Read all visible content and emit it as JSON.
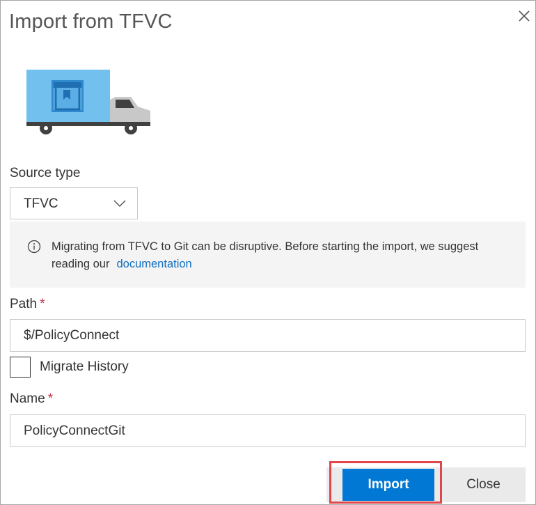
{
  "dialog": {
    "title": "Import from TFVC",
    "close_icon": "close-icon",
    "illustration": "truck-illustration"
  },
  "source_type": {
    "label": "Source type",
    "value": "TFVC",
    "icon": "chevron-down-icon"
  },
  "info": {
    "icon": "info-icon",
    "text": "Migrating from TFVC to Git can be disruptive. Before starting the import, we suggest reading our",
    "link_text": "documentation"
  },
  "path": {
    "label": "Path",
    "required_mark": "*",
    "value": "$/PolicyConnect"
  },
  "migrate_history": {
    "label": "Migrate History",
    "checked": false
  },
  "name": {
    "label": "Name",
    "required_mark": "*",
    "value": "PolicyConnectGit"
  },
  "buttons": {
    "import_label": "Import",
    "close_label": "Close"
  },
  "colors": {
    "primary": "#0078d4",
    "link": "#106ebe",
    "highlight": "#e0474c",
    "truck_box": "#72c0ed",
    "truck_cab": "#c8c8c8"
  }
}
